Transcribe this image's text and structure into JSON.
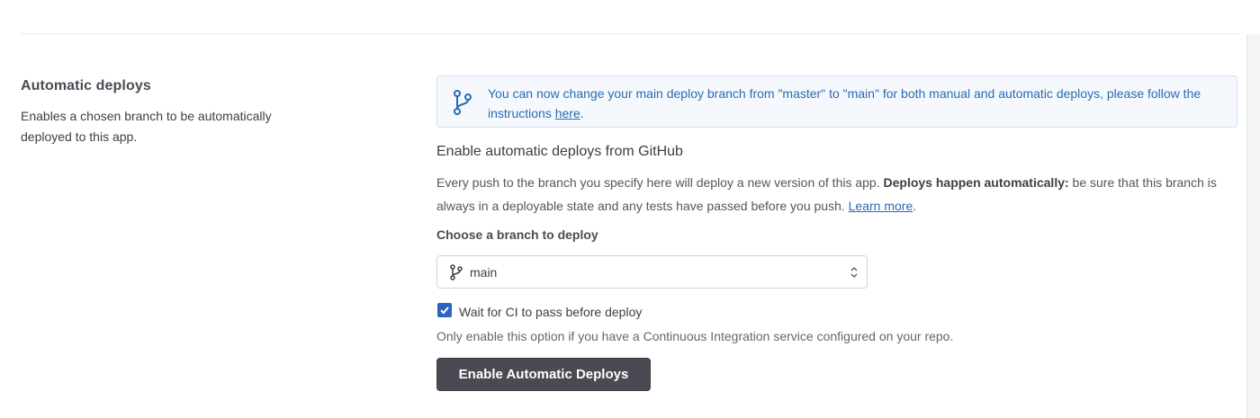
{
  "section": {
    "title": "Automatic deploys",
    "description": "Enables a chosen branch to be automatically deployed to this app."
  },
  "notice": {
    "text_before": "You can now change your main deploy branch from \"master\" to \"main\" for both manual and automatic deploys, please follow the instructions ",
    "link_text": "here",
    "text_after": ".",
    "icon": "git-branch-icon",
    "color": "#2a6ab5"
  },
  "github": {
    "heading": "Enable automatic deploys from GitHub",
    "desc_before": "Every push to the branch you specify here will deploy a new version of this app. ",
    "desc_bold": "Deploys happen automatically:",
    "desc_after": " be sure that this branch is always in a deployable state and any tests have passed before you push. ",
    "learn_more": "Learn more",
    "desc_end": "."
  },
  "branch": {
    "label": "Choose a branch to deploy",
    "selected": "main",
    "icon": "git-branch-icon"
  },
  "ci": {
    "checked": true,
    "label": "Wait for CI to pass before deploy",
    "help": "Only enable this option if you have a Continuous Integration service configured on your repo."
  },
  "button": {
    "label": "Enable Automatic Deploys",
    "bg_color": "#4a4b52"
  }
}
